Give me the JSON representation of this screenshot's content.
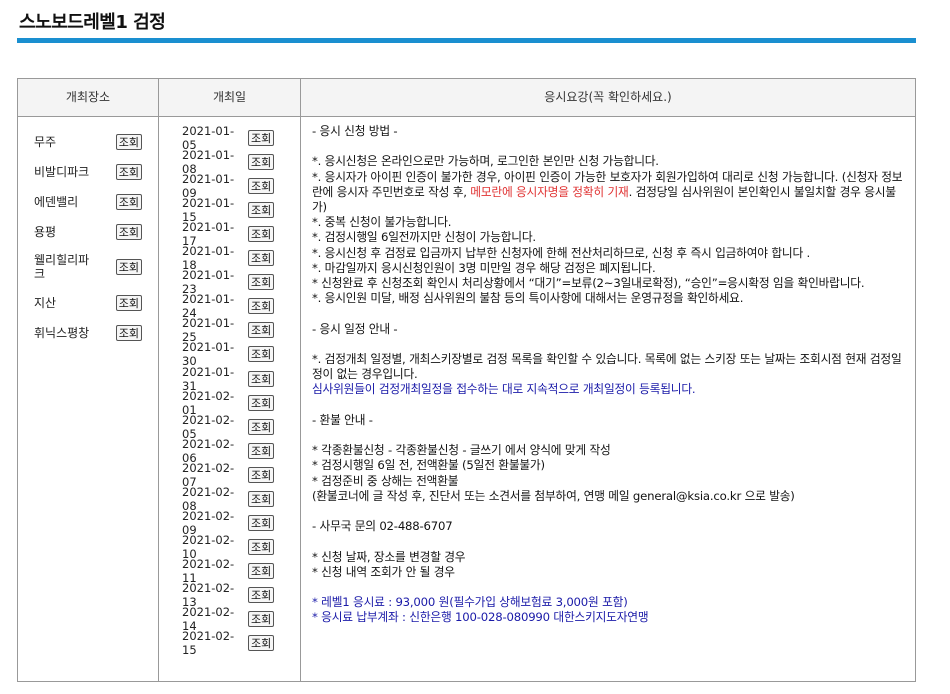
{
  "page": {
    "title": "스노보드레벨1 검정"
  },
  "table": {
    "headers": {
      "venue": "개최장소",
      "date": "개최일",
      "guide": "응시요강(꼭 확인하세요.)"
    },
    "lookup_label": "조회",
    "venues": [
      {
        "name": "무주"
      },
      {
        "name": "비발디파크"
      },
      {
        "name": "에덴밸리"
      },
      {
        "name": "용평"
      },
      {
        "name": "웰리힐리파크"
      },
      {
        "name": "지산"
      },
      {
        "name": "휘닉스평창"
      }
    ],
    "dates": [
      "2021-01-05",
      "2021-01-08",
      "2021-01-09",
      "2021-01-15",
      "2021-01-17",
      "2021-01-18",
      "2021-01-23",
      "2021-01-24",
      "2021-01-25",
      "2021-01-30",
      "2021-01-31",
      "2021-02-01",
      "2021-02-05",
      "2021-02-06",
      "2021-02-07",
      "2021-02-08",
      "2021-02-09",
      "2021-02-10",
      "2021-02-11",
      "2021-02-13",
      "2021-02-14",
      "2021-02-15"
    ]
  },
  "guide": {
    "apply_heading": "- 응시 신청 방법 -",
    "apply_1": "*. 응시신청은 온라인으로만 가능하며, 로그인한 본인만 신청 가능합니다.",
    "apply_2": "*. 응시자가 아이핀 인증이 불가한 경우, 아이핀 인증이 가능한 보호자가 회원가입하여 대리로 신청 가능합니다. (신청자 정보란에 응시자 주민번호로 작성 후, ",
    "apply_2_red": "메모란에 응시자명을 정확히 기재",
    "apply_2_tail": ". 검정당일 심사위원이 본인확인시 불일치할 경우 응시불가)",
    "apply_3": "*. 중복 신청이 불가능합니다.",
    "apply_4": "*. 검정시행일 6일전까지만 신청이 가능합니다.",
    "apply_5": "*. 응시신청 후 검정료 입금까지 납부한 신청자에 한해 전산처리하므로, 신청 후 즉시 입금하여야 합니다 .",
    "apply_6": "*. 마감일까지 응시신청인원이 3명 미만일 경우 해당 검정은 폐지됩니다.",
    "apply_7": "* 신청완료 후 신청조회 확인시 처리상황에서 “대기”=보류(2~3일내로확정), “승인”=응시확정 임을 확인바랍니다.",
    "apply_8": "*. 응시인원 미달, 배정 심사위원의 불참 등의 특이사항에 대해서는 운영규정을 확인하세요.",
    "schedule_heading": "- 응시 일정 안내 -",
    "schedule_1": "*. 검정개최 일정별, 개최스키장별로 검정 목록을 확인할 수 있습니다. 목록에 없는 스키장 또는 날짜는 조회시점 현재 검정일정이 없는 경우입니다.",
    "schedule_blue": "심사위원들이 검정개최일정을 접수하는 대로 지속적으로 개최일정이 등록됩니다.",
    "refund_heading": "- 환불 안내 -",
    "refund_1": "* 각종환불신청 - 각종환불신청 - 글쓰기 에서 양식에 맞게 작성",
    "refund_2": "* 검정시행일 6일 전, 전액환불 (5일전 환불불가)",
    "refund_3": "* 검정준비 중 상해는 전액환불",
    "refund_4": "(환불코너에 글 작성 후, 진단서 또는 소견서를 첨부하여, 연맹 메일 general@ksia.co.kr 으로 발송)",
    "office": "- 사무국 문의 02-488-6707",
    "office_1": "* 신청 날짜, 장소를 변경할 경우",
    "office_2": "* 신청 내역 조회가 안 될 경우",
    "fee_1": "* 레벨1 응시료 : 93,000 원(필수가입 상해보험료 3,000원 포함)",
    "fee_2": "* 응시료 납부계좌 : 신한은행 100-028-080990 대한스키지도자연맹"
  },
  "colors": {
    "accent_bar": "#1a8fd0",
    "highlight_red": "#e03131",
    "highlight_blue": "#1a1aa8"
  }
}
